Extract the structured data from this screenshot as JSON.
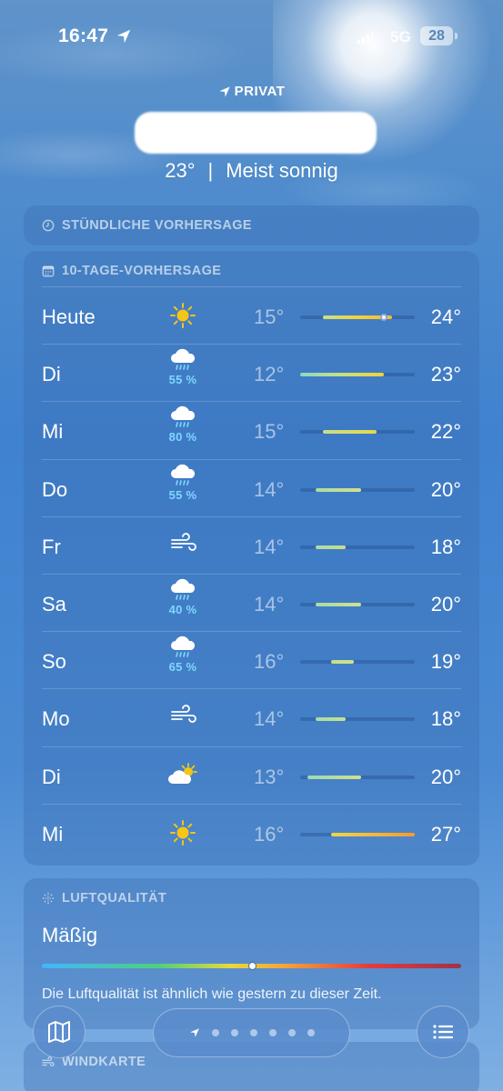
{
  "status_bar": {
    "time": "16:47",
    "network": "5G",
    "battery": "28"
  },
  "header": {
    "label": "PRIVAT",
    "temperature": "23°",
    "separator": "|",
    "condition": "Meist sonnig"
  },
  "hourly": {
    "title": "STÜNDLICHE VORHERSAGE"
  },
  "tenday": {
    "title": "10-TAGE-VORHERSAGE",
    "range_min": 12,
    "range_max": 27,
    "days": [
      {
        "day": "Heute",
        "icon": "sun",
        "precip": "",
        "low": "15°",
        "high": "24°",
        "low_val": 15,
        "high_val": 24,
        "current": 23,
        "bar_color": "linear-gradient(90deg,#c6e08a,#f2d23a,#f6b93a)"
      },
      {
        "day": "Di",
        "icon": "rain",
        "precip": "55 %",
        "low": "12°",
        "high": "23°",
        "low_val": 12,
        "high_val": 23,
        "bar_color": "linear-gradient(90deg,#8ed8c8,#c9e07f,#f2d23a)"
      },
      {
        "day": "Mi",
        "icon": "rain",
        "precip": "80 %",
        "low": "15°",
        "high": "22°",
        "low_val": 15,
        "high_val": 22,
        "bar_color": "linear-gradient(90deg,#c6e08a,#e8d84a)"
      },
      {
        "day": "Do",
        "icon": "rain",
        "precip": "55 %",
        "low": "14°",
        "high": "20°",
        "low_val": 14,
        "high_val": 20,
        "bar_color": "linear-gradient(90deg,#a8dca8,#d2e08a)"
      },
      {
        "day": "Fr",
        "icon": "wind",
        "precip": "",
        "low": "14°",
        "high": "18°",
        "low_val": 14,
        "high_val": 18,
        "bar_color": "linear-gradient(90deg,#a8dca8,#c6e08a)"
      },
      {
        "day": "Sa",
        "icon": "rain",
        "precip": "40 %",
        "low": "14°",
        "high": "20°",
        "low_val": 14,
        "high_val": 20,
        "bar_color": "linear-gradient(90deg,#a8dca8,#d2e08a)"
      },
      {
        "day": "So",
        "icon": "rain",
        "precip": "65 %",
        "low": "16°",
        "high": "19°",
        "low_val": 16,
        "high_val": 19,
        "bar_color": "linear-gradient(90deg,#c6e08a,#d2e08a)"
      },
      {
        "day": "Mo",
        "icon": "wind",
        "precip": "",
        "low": "14°",
        "high": "18°",
        "low_val": 14,
        "high_val": 18,
        "bar_color": "linear-gradient(90deg,#a8dca8,#c6e08a)"
      },
      {
        "day": "Di",
        "icon": "partly-cloudy",
        "precip": "",
        "low": "13°",
        "high": "20°",
        "low_val": 13,
        "high_val": 20,
        "bar_color": "linear-gradient(90deg,#9ad9b8,#d2e08a)"
      },
      {
        "day": "Mi",
        "icon": "sun",
        "precip": "",
        "low": "16°",
        "high": "27°",
        "low_val": 16,
        "high_val": 27,
        "bar_color": "linear-gradient(90deg,#e8d84a,#f6b93a,#f59a2e)"
      }
    ]
  },
  "air_quality": {
    "title": "LUFTQUALITÄT",
    "level": "Mäßig",
    "index_fraction": 0.5,
    "description": "Die Luftqualität ist ähnlich wie gestern zu dieser Zeit."
  },
  "wind_map": {
    "title": "WINDKARTE"
  },
  "toolbar": {
    "page_count": 7
  }
}
